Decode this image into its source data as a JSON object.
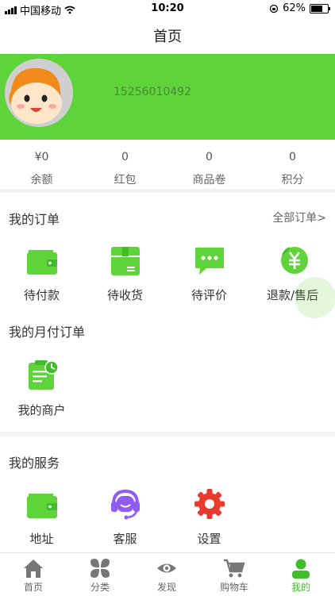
{
  "status": {
    "carrier": "中国移动",
    "time": "10:20",
    "battery": "62%"
  },
  "nav": {
    "title": "首页"
  },
  "profile": {
    "phone": "15256010492"
  },
  "stats": [
    {
      "value": "¥0",
      "label": "余额"
    },
    {
      "value": "0",
      "label": "红包"
    },
    {
      "value": "0",
      "label": "商品卷"
    },
    {
      "value": "0",
      "label": "积分"
    }
  ],
  "orders": {
    "title": "我的订单",
    "more": "全部订单>",
    "items": [
      {
        "label": "待付款",
        "icon": "wallet-icon"
      },
      {
        "label": "待收货",
        "icon": "box-icon"
      },
      {
        "label": "待评价",
        "icon": "chat-icon"
      },
      {
        "label": "退款/售后",
        "icon": "yen-refund-icon"
      }
    ]
  },
  "monthly": {
    "title": "我的月付订单",
    "items": [
      {
        "label": "我的商户",
        "icon": "clipboard-clock-icon"
      }
    ]
  },
  "services": {
    "title": "我的服务",
    "items": [
      {
        "label": "地址",
        "icon": "wallet-icon"
      },
      {
        "label": "客服",
        "icon": "headset-icon"
      },
      {
        "label": "设置",
        "icon": "gear-icon"
      }
    ]
  },
  "tabs": [
    {
      "label": "首页",
      "icon": "home-icon"
    },
    {
      "label": "分类",
      "icon": "category-icon"
    },
    {
      "label": "发现",
      "icon": "eye-icon"
    },
    {
      "label": "购物车",
      "icon": "cart-icon"
    },
    {
      "label": "我的",
      "icon": "user-icon",
      "active": true
    }
  ],
  "colors": {
    "brand": "#5ed33a",
    "active_tab": "#3fbe2a",
    "service_purple": "#8f5cf6",
    "settings_red": "#e83b2e"
  }
}
